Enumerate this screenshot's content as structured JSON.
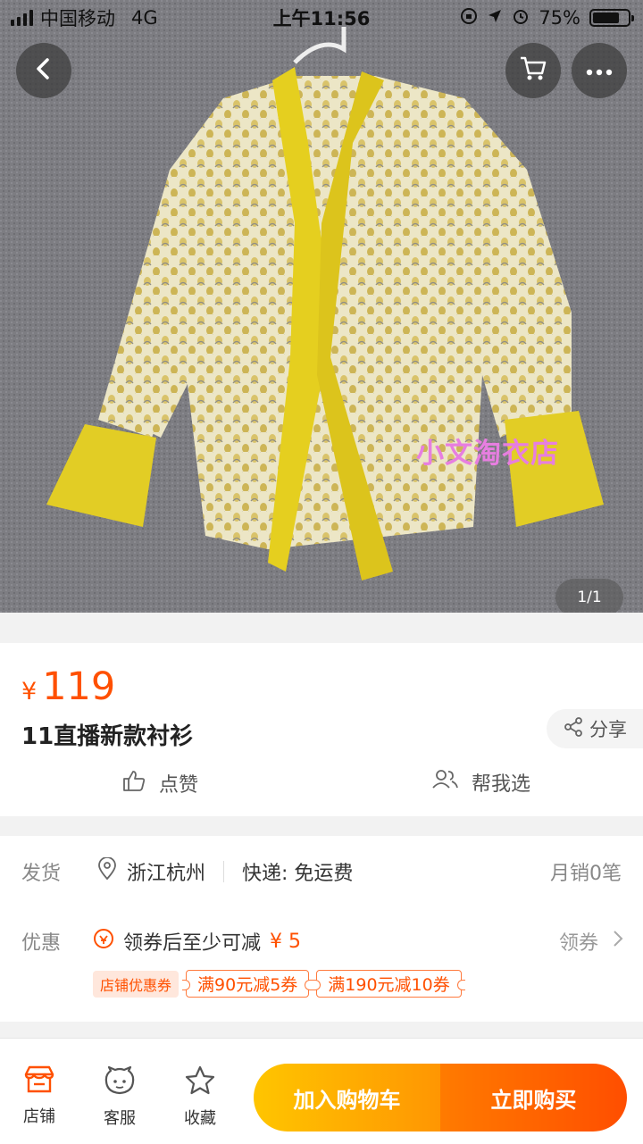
{
  "status_bar": {
    "carrier": "中国移动",
    "network": "4G",
    "time": "上午11:56",
    "battery_percent": "75%",
    "battery_level": 0.75
  },
  "hero": {
    "image_counter": "1/1",
    "watermark": "小文淘衣店",
    "back_icon": "chevron-left-icon",
    "cart_icon": "cart-icon",
    "more_icon": "more-dots-icon"
  },
  "product": {
    "currency": "¥",
    "price": "119",
    "title": "11直播新款衬衫",
    "share_label": "分享",
    "like_label": "点赞",
    "help_choose_label": "帮我选"
  },
  "delivery": {
    "ship_label": "发货",
    "location": "浙江杭州",
    "express": "快递: 免运费",
    "monthly_sales": "月销0笔",
    "promo_label": "优惠",
    "coupon_text": "领券后至少可减",
    "coupon_amount": "¥ 5",
    "collect_label": "领券",
    "shop_coupon_tag": "店铺优惠券",
    "coupons": [
      "满90元减5券",
      "满190元减10券"
    ]
  },
  "bottom_bar": {
    "shop_label": "店铺",
    "service_label": "客服",
    "favorite_label": "收藏",
    "add_to_cart_label": "加入购物车",
    "buy_now_label": "立即购买"
  },
  "colors": {
    "accent": "#ff5000",
    "cart_button_gradient": [
      "#ffc500",
      "#ff9602"
    ],
    "buy_button_gradient": [
      "#ff7b00",
      "#ff4e00"
    ]
  }
}
